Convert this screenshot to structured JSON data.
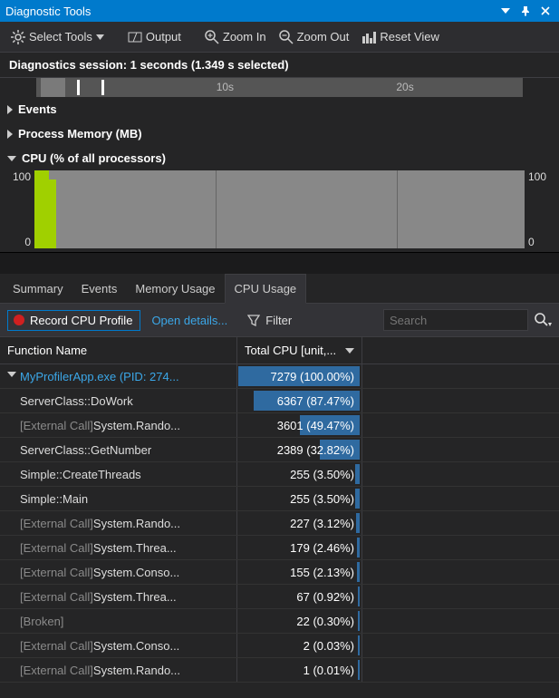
{
  "title": "Diagnostic Tools",
  "toolbar": {
    "select_tools": "Select Tools",
    "output": "Output",
    "zoom_in": "Zoom In",
    "zoom_out": "Zoom Out",
    "reset_view": "Reset View"
  },
  "session_text": "Diagnostics session: 1 seconds (1.349 s selected)",
  "ruler": {
    "t1": "10s",
    "t2": "20s"
  },
  "sections": {
    "events": "Events",
    "memory": "Process Memory (MB)",
    "cpu": "CPU (% of all processors)"
  },
  "chart_data": {
    "type": "area",
    "title": "CPU (% of all processors)",
    "ylabel": "%",
    "ylim": [
      0,
      100
    ],
    "yticks": [
      0,
      100
    ],
    "x_unit": "s",
    "series": [
      {
        "name": "CPU %",
        "description": "brief ~100% spike at session start, otherwise unrecorded"
      }
    ]
  },
  "tabs": {
    "summary": "Summary",
    "events": "Events",
    "memory": "Memory Usage",
    "cpu": "CPU Usage"
  },
  "cmd": {
    "record": "Record CPU Profile",
    "open_details": "Open details...",
    "filter": "Filter",
    "search_placeholder": "Search"
  },
  "columns": {
    "func": "Function Name",
    "total": "Total CPU [unit,..."
  },
  "rows": [
    {
      "name_html": "MyProfilerApp.exe (PID: 274...",
      "external": false,
      "first": true,
      "value": 7279,
      "pct": 100.0,
      "display": "7279 (100.00%)"
    },
    {
      "name_html": "ServerClass::DoWork",
      "external": false,
      "value": 6367,
      "pct": 87.47,
      "display": "6367 (87.47%)"
    },
    {
      "pre": "[External Call] ",
      "name_html": "System.Rando...",
      "external": true,
      "value": 3601,
      "pct": 49.47,
      "display": "3601 (49.47%)"
    },
    {
      "name_html": "ServerClass::GetNumber",
      "external": false,
      "value": 2389,
      "pct": 32.82,
      "display": "2389 (32.82%)"
    },
    {
      "name_html": "Simple::CreateThreads",
      "external": false,
      "value": 255,
      "pct": 3.5,
      "display": "255 (3.50%)"
    },
    {
      "name_html": "Simple::Main",
      "external": false,
      "value": 255,
      "pct": 3.5,
      "display": "255 (3.50%)"
    },
    {
      "pre": "[External Call] ",
      "name_html": "System.Rando...",
      "external": true,
      "value": 227,
      "pct": 3.12,
      "display": "227 (3.12%)"
    },
    {
      "pre": "[External Call] ",
      "name_html": "System.Threa...",
      "external": true,
      "value": 179,
      "pct": 2.46,
      "display": "179 (2.46%)"
    },
    {
      "pre": "[External Call] ",
      "name_html": "System.Conso...",
      "external": true,
      "value": 155,
      "pct": 2.13,
      "display": "155 (2.13%)"
    },
    {
      "pre": "[External Call] ",
      "name_html": "System.Threa...",
      "external": true,
      "value": 67,
      "pct": 0.92,
      "display": "67 (0.92%)"
    },
    {
      "pre": "[Broken]",
      "name_html": "",
      "external": true,
      "fullgray": true,
      "value": 22,
      "pct": 0.3,
      "display": "22 (0.30%)"
    },
    {
      "pre": "[External Call] ",
      "name_html": "System.Conso...",
      "external": true,
      "value": 2,
      "pct": 0.03,
      "display": "2 (0.03%)"
    },
    {
      "pre": "[External Call] ",
      "name_html": "System.Rando...",
      "external": true,
      "value": 1,
      "pct": 0.01,
      "display": "1 (0.01%)"
    }
  ]
}
